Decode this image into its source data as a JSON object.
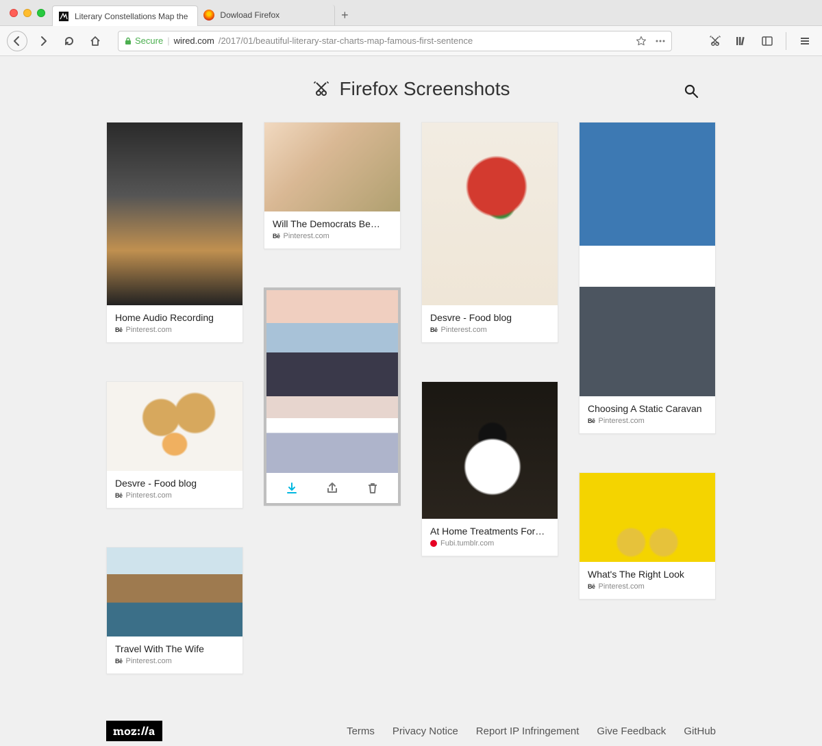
{
  "tabs": [
    {
      "label": "Literary Constellations Map the",
      "active": true
    },
    {
      "label": "Dowload Firefox",
      "active": false
    }
  ],
  "toolbar": {
    "secure_label": "Secure",
    "url_domain": "wired.com",
    "url_path": "/2017/01/beautiful-literary-star-charts-map-famous-first-sentence"
  },
  "page": {
    "title": "Firefox Screenshots"
  },
  "cards": [
    {
      "title": "Home Audio Recording",
      "source": "Pinterest.com",
      "icon": "be",
      "thumb": "th-boxing",
      "thumb_h": 267
    },
    {
      "title": "Desvre - Food blog",
      "source": "Pinterest.com",
      "icon": "be",
      "thumb": "th-pancake",
      "thumb_h": 130
    },
    {
      "title": "Travel With The Wife",
      "source": "Pinterest.com",
      "icon": "be",
      "thumb": "th-coast",
      "thumb_h": 130
    },
    {
      "title": "Will The Democrats Be…",
      "source": "Pinterest.com",
      "icon": "be",
      "thumb": "th-grass",
      "thumb_h": 130
    },
    {
      "selected": true,
      "thumb": "th-mountain",
      "thumb_h": 267,
      "actions": true
    },
    {
      "title": "Desvre - Food blog",
      "source": "Pinterest.com",
      "icon": "be",
      "thumb": "th-berry",
      "thumb_h": 267
    },
    {
      "title": "At Home Treatments For…",
      "source": "Fubi.tumblr.com",
      "icon": "pin",
      "thumb": "th-coffee",
      "thumb_h": 200
    },
    {
      "title": "Choosing A Static Caravan",
      "source": "Pinterest.com",
      "icon": "be",
      "thumb": "th-summit",
      "thumb_h": 400
    },
    {
      "title": "What's The Right Look",
      "source": "Pinterest.com",
      "icon": "be",
      "thumb": "th-shoes",
      "thumb_h": 130
    }
  ],
  "footer": {
    "links": [
      "Terms",
      "Privacy Notice",
      "Report IP Infringement",
      "Give Feedback",
      "GitHub"
    ],
    "logo": "moz://a"
  },
  "columns": [
    [
      0,
      1,
      2
    ],
    [
      3,
      4
    ],
    [
      5,
      6
    ],
    [
      7,
      8
    ]
  ]
}
